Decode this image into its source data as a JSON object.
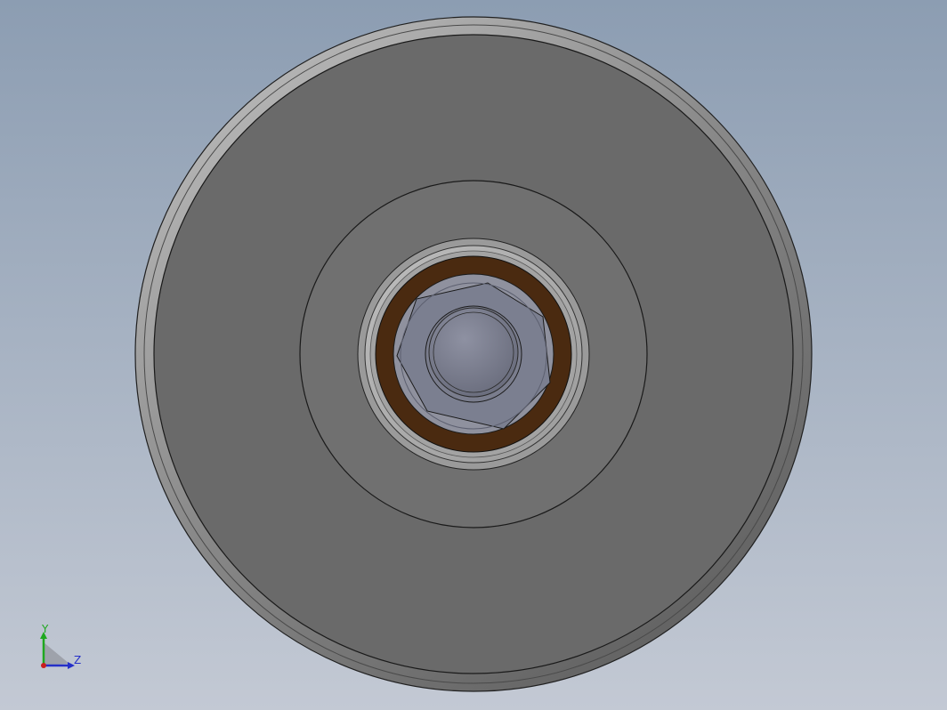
{
  "viewport": {
    "background_top": "#8c9db2",
    "background_bottom": "#c3c9d4"
  },
  "part": {
    "rim_color": "#8e8e8e",
    "face_color": "#6a6a6a",
    "hub_face_color": "#707070",
    "bearing_shield_color": "#a9a9a9",
    "bearing_seal_color": "#4a2a10",
    "bolt_color": "#7d8090",
    "outline_color": "#202020"
  },
  "triad": {
    "y_axis_label": "Y",
    "z_axis_label": "Z",
    "y_axis_color": "#1fa81f",
    "z_axis_color": "#2530c8",
    "origin_color": "#c81e1e"
  }
}
